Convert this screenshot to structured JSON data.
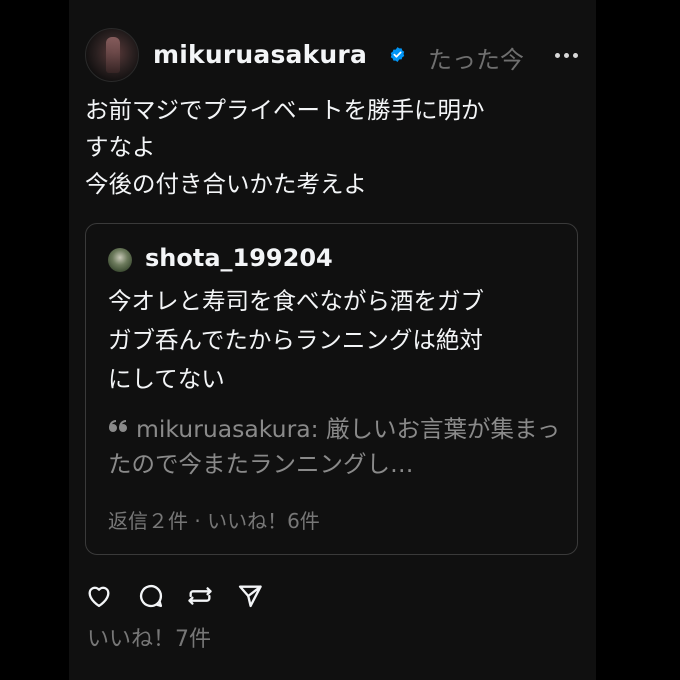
{
  "post": {
    "username": "mikuruasakura",
    "timestamp": "たった今",
    "text": "お前マジでプライベートを勝手に明か\nすなよ\n今後の付き合いかた考えよ"
  },
  "quote": {
    "username": "shota_199204",
    "text": "今オレと寿司を食べながら酒をガブ\nガブ呑んでたからランニングは絶対\nにしてない",
    "nested": {
      "text": "mikuruasakura: 厳しいお言葉が集まったので今またランニングし…"
    },
    "stats": "返信２件 · いいね！6件"
  },
  "likes": "いいね！7件",
  "colors": {
    "background": "#101010",
    "text": "#f3f5f7",
    "muted": "#777777",
    "verified": "#0095f6"
  },
  "icons": {
    "verified": "verified-badge-icon",
    "more": "more-horizontal-icon",
    "like": "heart-icon",
    "comment": "comment-icon",
    "repost": "repost-icon",
    "share": "send-icon",
    "quote_mark": "quote-mark-icon"
  }
}
